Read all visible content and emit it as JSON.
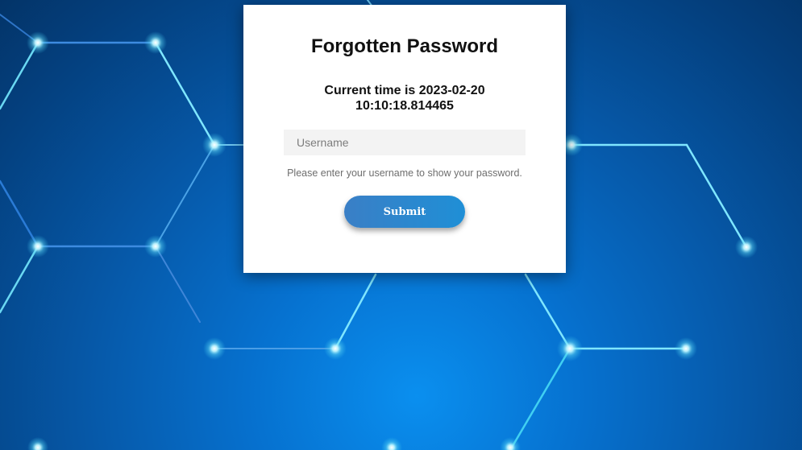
{
  "form": {
    "title": "Forgotten Password",
    "current_time": "Current time is 2023-02-20 10:10:18.814465",
    "username_placeholder": "Username",
    "username_value": "",
    "hint": "Please enter your username to show your password.",
    "submit_label": "Submit"
  },
  "colors": {
    "background_center": "#0a8fef",
    "background_edge": "#033468",
    "card": "#ffffff",
    "button": "#1f8fd6",
    "network_line": "#7fe6ff"
  }
}
